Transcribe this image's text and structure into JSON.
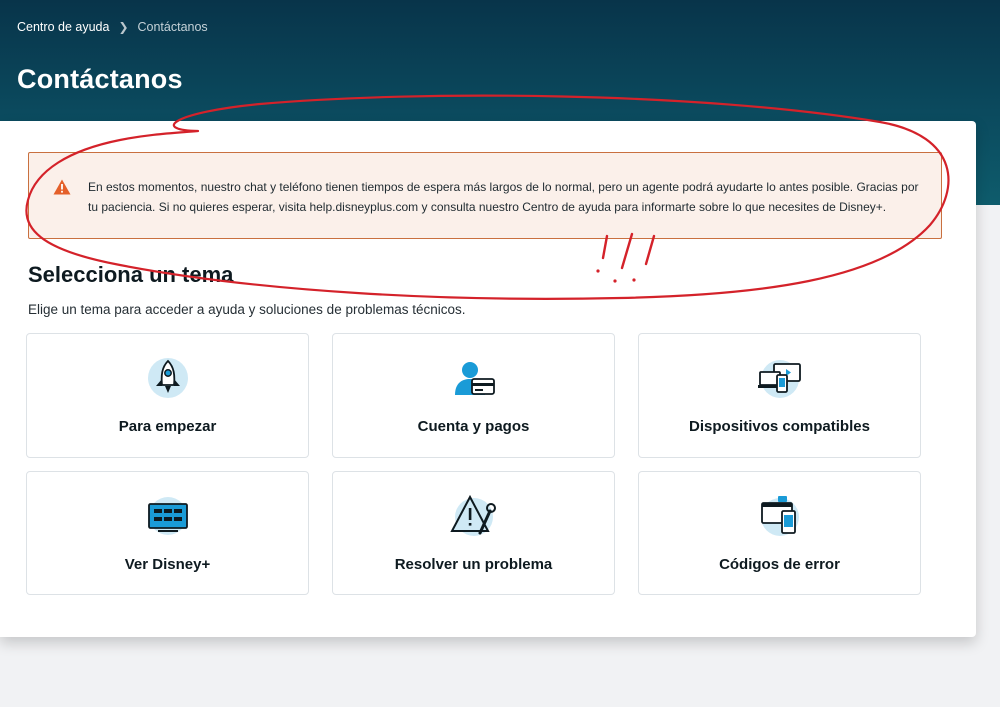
{
  "breadcrumb": {
    "home": "Centro de ayuda",
    "current": "Contáctanos"
  },
  "header": {
    "title": "Contáctanos"
  },
  "alert": {
    "text": "En estos momentos, nuestro chat y teléfono tienen tiempos de espera más largos de lo normal, pero un agente podrá ayudarte lo antes posible. Gracias por tu paciencia. Si no quieres esperar, visita help.disneyplus.com y consulta nuestro Centro de ayuda para informarte sobre lo que necesites de Disney+.",
    "icon": "warning-icon",
    "color": "#e4602a"
  },
  "topics": {
    "title": "Selecciona un tema",
    "subtitle": "Elige un tema para acceder a ayuda y soluciones de problemas técnicos.",
    "items": [
      {
        "label": "Para empezar",
        "icon": "rocket-icon"
      },
      {
        "label": "Cuenta y pagos",
        "icon": "account-payment-icon"
      },
      {
        "label": "Dispositivos compatibles",
        "icon": "devices-icon"
      },
      {
        "label": "Ver Disney+",
        "icon": "tv-grid-icon"
      },
      {
        "label": "Resolver un problema",
        "icon": "troubleshoot-icon"
      },
      {
        "label": "Códigos de error",
        "icon": "error-codes-icon"
      }
    ]
  },
  "colors": {
    "header_bg": "#08344a",
    "icon_accent": "#1a9bd7",
    "icon_circle": "#cfe9f5",
    "annotation": "#d4222a"
  }
}
